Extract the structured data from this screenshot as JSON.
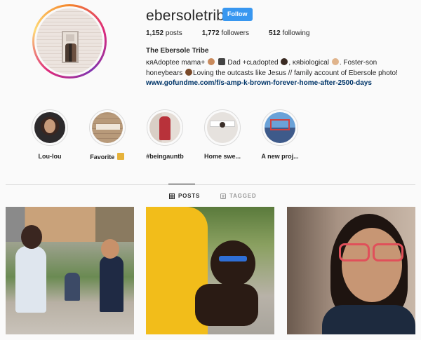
{
  "profile": {
    "username": "ebersoletribe",
    "follow_label": "Follow",
    "posts_count": "1,152",
    "posts_label": "posts",
    "followers_count": "1,772",
    "followers_label": "followers",
    "following_count": "512",
    "following_label": "following",
    "full_name": "The Ebersole Tribe",
    "bio_line1": "ĸяAdoptee mama+",
    "bio_line1b": "Dad +cʟadopted",
    "bio_line1c": ", ĸяbiological",
    "bio_line1d": ". Foster-son",
    "bio_line2a": "honeybears",
    "bio_line2b": "Loving the outcasts like Jesus // family account of Ebersole photo!",
    "link": "www.gofundme.com/f/s-amp-k-brown-forever-home-after-2500-days"
  },
  "highlights": [
    {
      "label": "Lou-lou"
    },
    {
      "label": "Favorite"
    },
    {
      "label": "#beingauntb"
    },
    {
      "label": "Home swe..."
    },
    {
      "label": "A new proj..."
    }
  ],
  "tabs": {
    "posts": "POSTS",
    "tagged": "TAGGED"
  },
  "colors": {
    "accent": "#3897f0",
    "link": "#003569",
    "active_tab": "#262626",
    "inactive_tab": "#999999"
  },
  "icons": {
    "follow": "none",
    "posts_tab": "grid-icon",
    "tagged_tab": "tag-icon"
  }
}
